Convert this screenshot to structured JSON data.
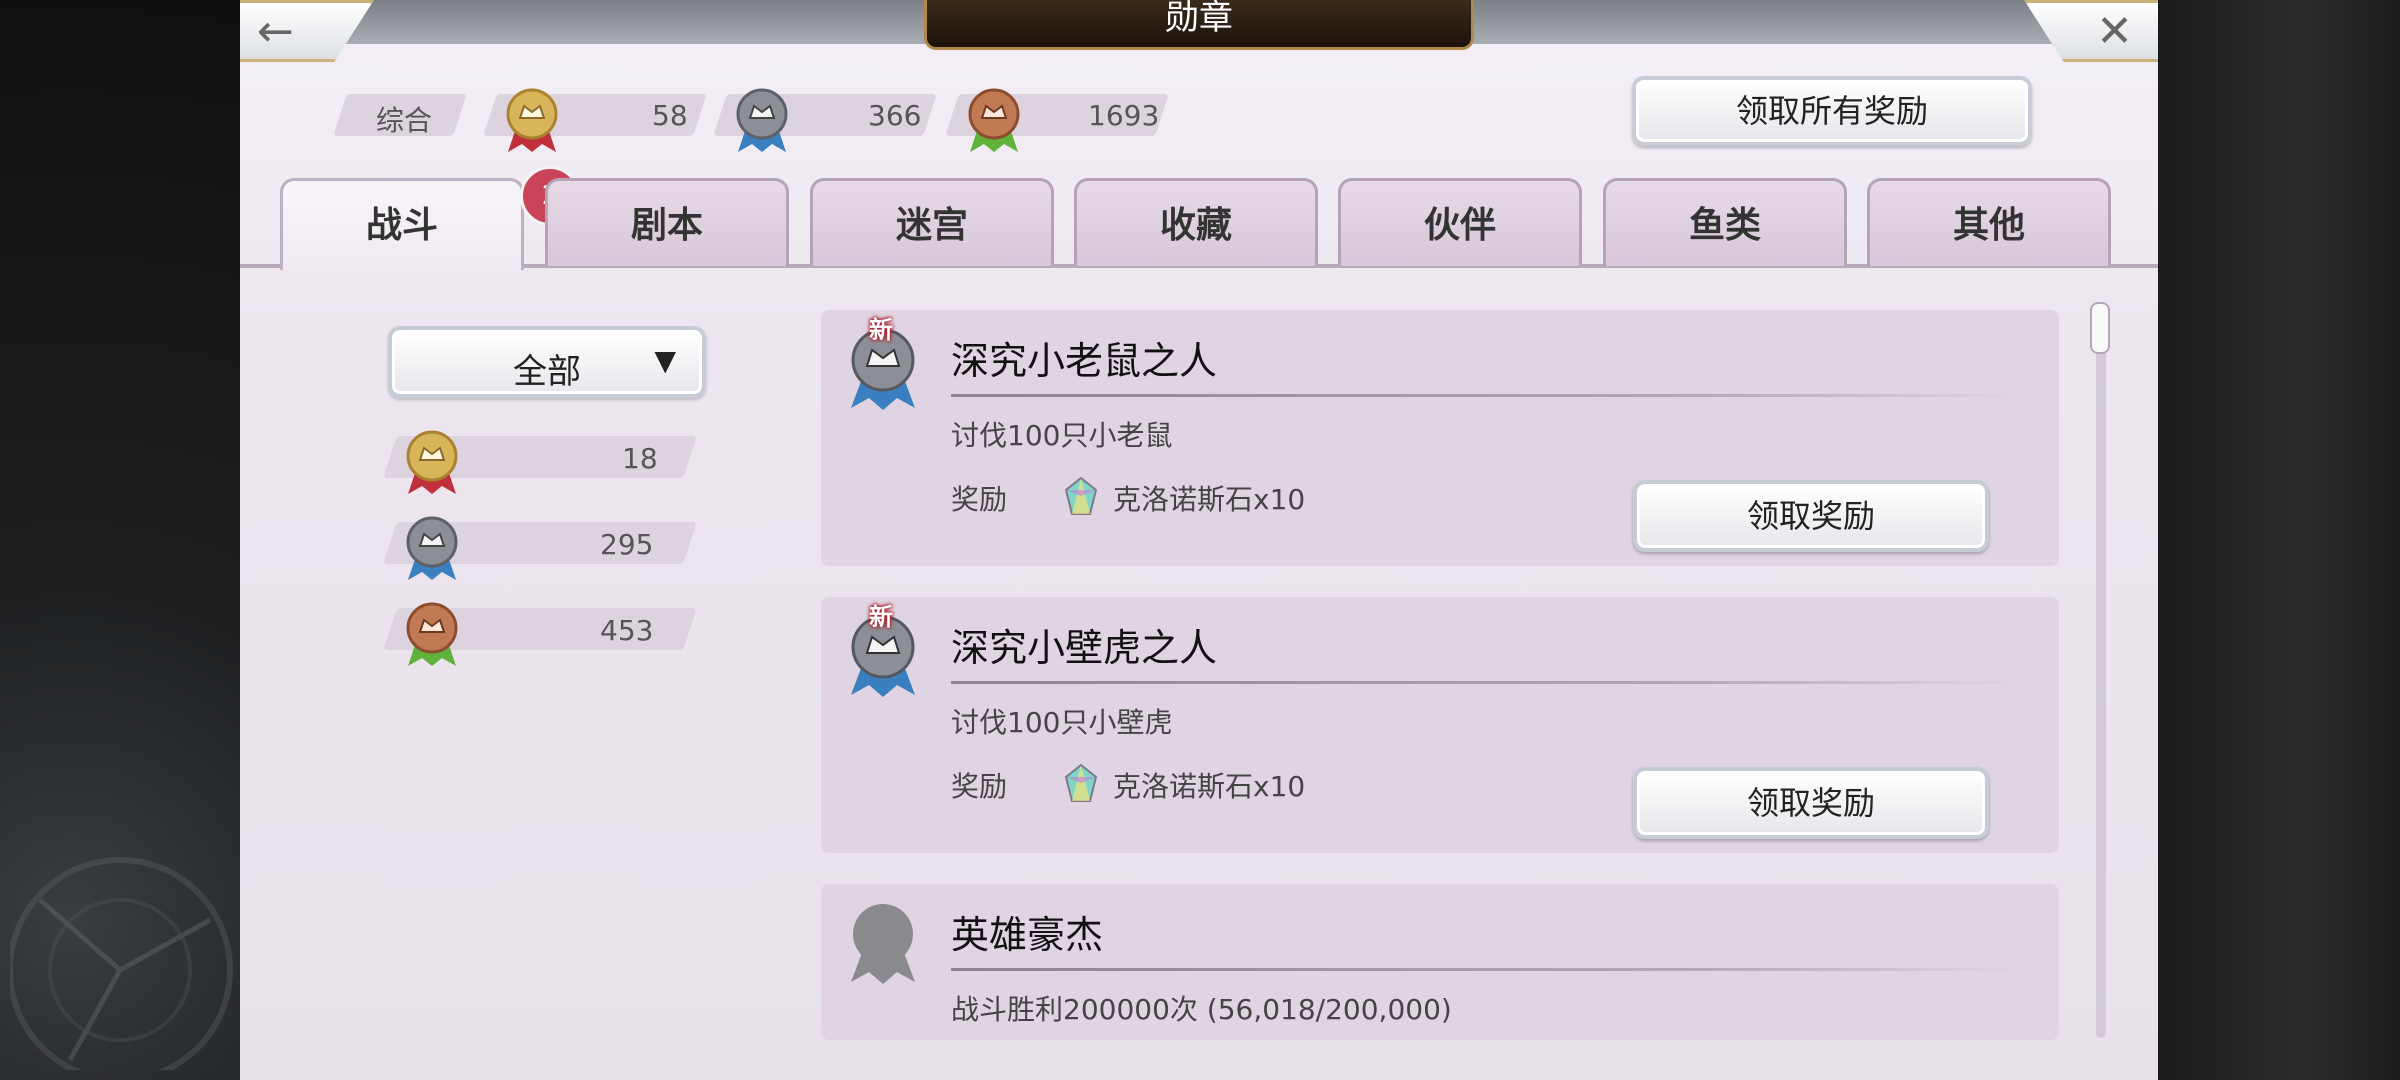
{
  "header": {
    "title": "勋章",
    "back_icon": "←",
    "close_icon": "✕"
  },
  "summary": {
    "label": "综合",
    "gold_count": "58",
    "silver_count": "366",
    "bronze_count": "1693",
    "claim_all_label": "领取所有奖励"
  },
  "tabs": [
    {
      "label": "战斗",
      "badge": "2"
    },
    {
      "label": "剧本"
    },
    {
      "label": "迷宫"
    },
    {
      "label": "收藏"
    },
    {
      "label": "伙伴"
    },
    {
      "label": "鱼类"
    },
    {
      "label": "其他"
    }
  ],
  "sidebar": {
    "filter_value": "全部",
    "filter_caret": "▼",
    "gold_count": "18",
    "silver_count": "295",
    "bronze_count": "453"
  },
  "cards": [
    {
      "new_tag": "新",
      "title": "深究小老鼠之人",
      "desc": "讨伐100只小老鼠",
      "reward_label": "奖励",
      "reward": "克洛诺斯石x10",
      "button": "领取奖励"
    },
    {
      "new_tag": "新",
      "title": "深究小壁虎之人",
      "desc": "讨伐100只小壁虎",
      "reward_label": "奖励",
      "reward": "克洛诺斯石x10",
      "button": "领取奖励"
    },
    {
      "title": "英雄豪杰",
      "desc": "战斗胜利200000次 (56,018/200,000)"
    }
  ],
  "colors": {
    "gold": "#d8b55a",
    "silver": "#8c9096",
    "bronze": "#c27a55",
    "red_ribbon": "#c0303a",
    "blue_ribbon": "#3a7fc0",
    "green_ribbon": "#5fb23a",
    "badge": "#c94458"
  }
}
